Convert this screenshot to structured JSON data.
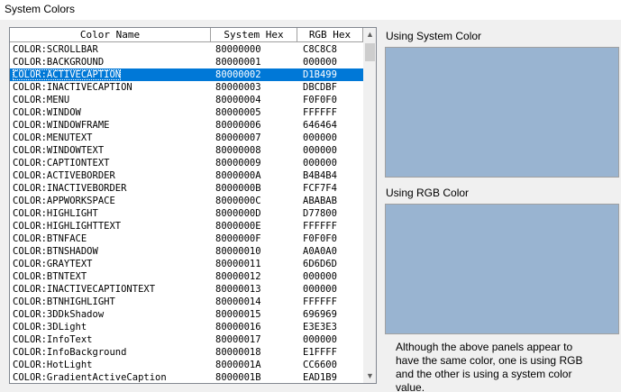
{
  "window": {
    "title": "System Colors"
  },
  "list": {
    "columns": [
      "Color Name",
      "System Hex",
      "RGB Hex"
    ],
    "selected_index": 2,
    "rows": [
      [
        "COLOR:SCROLLBAR",
        "80000000",
        "C8C8C8"
      ],
      [
        "COLOR:BACKGROUND",
        "80000001",
        "000000"
      ],
      [
        "COLOR:ACTIVECAPTION",
        "80000002",
        "D1B499"
      ],
      [
        "COLOR:INACTIVECAPTION",
        "80000003",
        "DBCDBF"
      ],
      [
        "COLOR:MENU",
        "80000004",
        "F0F0F0"
      ],
      [
        "COLOR:WINDOW",
        "80000005",
        "FFFFFF"
      ],
      [
        "COLOR:WINDOWFRAME",
        "80000006",
        "646464"
      ],
      [
        "COLOR:MENUTEXT",
        "80000007",
        "000000"
      ],
      [
        "COLOR:WINDOWTEXT",
        "80000008",
        "000000"
      ],
      [
        "COLOR:CAPTIONTEXT",
        "80000009",
        "000000"
      ],
      [
        "COLOR:ACTIVEBORDER",
        "8000000A",
        "B4B4B4"
      ],
      [
        "COLOR:INACTIVEBORDER",
        "8000000B",
        "FCF7F4"
      ],
      [
        "COLOR:APPWORKSPACE",
        "8000000C",
        "ABABAB"
      ],
      [
        "COLOR:HIGHLIGHT",
        "8000000D",
        "D77800"
      ],
      [
        "COLOR:HIGHLIGHTTEXT",
        "8000000E",
        "FFFFFF"
      ],
      [
        "COLOR:BTNFACE",
        "8000000F",
        "F0F0F0"
      ],
      [
        "COLOR:BTNSHADOW",
        "80000010",
        "A0A0A0"
      ],
      [
        "COLOR:GRAYTEXT",
        "80000011",
        "6D6D6D"
      ],
      [
        "COLOR:BTNTEXT",
        "80000012",
        "000000"
      ],
      [
        "COLOR:INACTIVECAPTIONTEXT",
        "80000013",
        "000000"
      ],
      [
        "COLOR:BTNHIGHLIGHT",
        "80000014",
        "FFFFFF"
      ],
      [
        "COLOR:3DDkShadow",
        "80000015",
        "696969"
      ],
      [
        "COLOR:3DLight",
        "80000016",
        "E3E3E3"
      ],
      [
        "COLOR:InfoText",
        "80000017",
        "000000"
      ],
      [
        "COLOR:InfoBackground",
        "80000018",
        "E1FFFF"
      ],
      [
        "COLOR:HotLight",
        "8000001A",
        "CC6600"
      ],
      [
        "COLOR:GradientActiveCaption",
        "8000001B",
        "EAD1B9"
      ]
    ]
  },
  "panels": {
    "system_label": "Using System Color",
    "rgb_label": "Using RGB Color",
    "swatch_color": "#99B4D1",
    "note": "Although the above panels appear to have the same color, one is using RGB and the other is using a system color value."
  },
  "icons": {
    "scroll_up": "chevron-up-icon",
    "scroll_down": "chevron-down-icon"
  }
}
